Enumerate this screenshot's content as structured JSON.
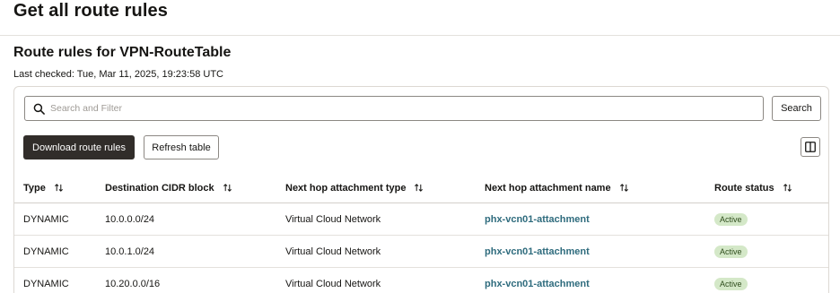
{
  "page": {
    "title": "Get all route rules"
  },
  "section": {
    "title": "Route rules for VPN-RouteTable",
    "last_checked": "Last checked: Tue, Mar 11, 2025, 19:23:58 UTC"
  },
  "search": {
    "placeholder": "Search and Filter",
    "value": "",
    "button_label": "Search"
  },
  "toolbar": {
    "download_label": "Download route rules",
    "refresh_label": "Refresh table",
    "columns_icon": "columns-icon"
  },
  "table": {
    "columns": [
      "Type",
      "Destination CIDR block",
      "Next hop attachment type",
      "Next hop attachment name",
      "Route status"
    ],
    "rows": [
      {
        "type": "DYNAMIC",
        "cidr": "10.0.0.0/24",
        "hop_type": "Virtual Cloud Network",
        "hop_name": "phx-vcn01-attachment",
        "status": "Active"
      },
      {
        "type": "DYNAMIC",
        "cidr": "10.0.1.0/24",
        "hop_type": "Virtual Cloud Network",
        "hop_name": "phx-vcn01-attachment",
        "status": "Active"
      },
      {
        "type": "DYNAMIC",
        "cidr": "10.20.0.0/16",
        "hop_type": "Virtual Cloud Network",
        "hop_name": "phx-vcn01-attachment",
        "status": "Active"
      }
    ]
  },
  "colors": {
    "primary_button": "#312d2a",
    "link": "#2e6b7d",
    "status_badge_bg": "#d4e8c8",
    "status_badge_text": "#2f4d1d"
  }
}
